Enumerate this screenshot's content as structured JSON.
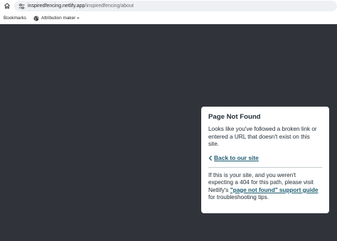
{
  "browser": {
    "url_host": "inspiredfencing.netlify.app",
    "url_path": "/inspiredfencing/about",
    "bookmarks": [
      {
        "label": "Bookmarks"
      },
      {
        "label": "Attribution maker »",
        "icon": "globe-icon"
      }
    ]
  },
  "page": {
    "background": "#30343a",
    "card": {
      "title": "Page Not Found",
      "message": "Looks like you've followed a broken link or entered a URL that doesn't exist on this site.",
      "back_link": "Back to our site",
      "note_prefix": "If this is your site, and you weren't expecting a 404 for this path, please visit Netlify's ",
      "note_link": "\"page not found\" support guide",
      "note_suffix": " for troubleshooting tips.",
      "link_color": "#1d5c70"
    }
  }
}
